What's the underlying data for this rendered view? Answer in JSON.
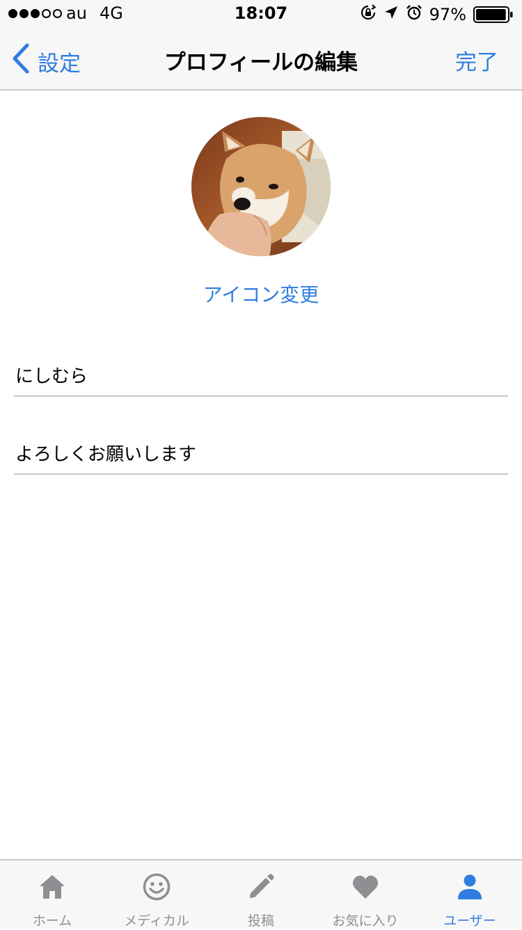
{
  "status_bar": {
    "carrier": "au",
    "network": "4G",
    "time": "18:07",
    "battery": "97%",
    "battery_level": 0.97,
    "signal_bars": 3,
    "icons": [
      "rotation-lock-icon",
      "location-arrow-icon",
      "alarm-icon",
      "battery-icon"
    ]
  },
  "nav": {
    "back_label": "設定",
    "title": "プロフィールの編集",
    "done_label": "完了"
  },
  "profile": {
    "avatar_icon": "shiba-dog-avatar",
    "change_icon_label": "アイコン変更",
    "name_value": "にしむら",
    "bio_value": "よろしくお願いします"
  },
  "tabbar": {
    "tabs": [
      {
        "label": "ホーム",
        "icon": "home-icon",
        "active": false
      },
      {
        "label": "メディカル",
        "icon": "smiley-icon",
        "active": false
      },
      {
        "label": "投稿",
        "icon": "pencil-icon",
        "active": false
      },
      {
        "label": "お気に入り",
        "icon": "heart-icon",
        "active": false
      },
      {
        "label": "ユーザー",
        "icon": "person-icon",
        "active": true
      }
    ]
  },
  "colors": {
    "accent": "#2f7de1",
    "inactive": "#8e8e93",
    "bar_background": "#f7f7f7"
  }
}
